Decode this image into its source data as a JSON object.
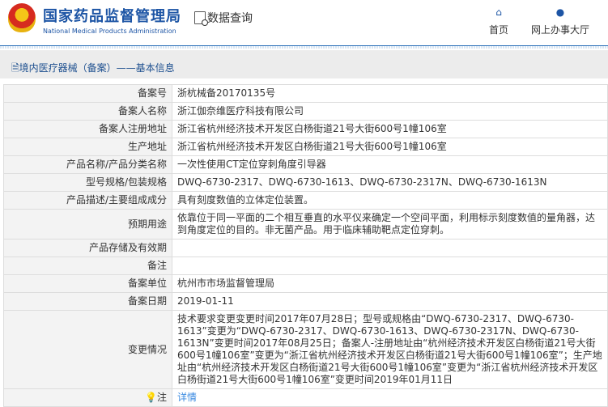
{
  "header": {
    "title_cn": "国家药品监督管理局",
    "title_en": "National Medical Products Administration",
    "section": "数据查询",
    "nav": [
      {
        "label": "首页",
        "icon": "home-icon"
      },
      {
        "label": "网上办事大厅",
        "icon": "user-icon"
      }
    ]
  },
  "breadcrumb": "境内医疗器械（备案）——基本信息",
  "rows": [
    {
      "k": "备案号",
      "v": "浙杭械备20170135号"
    },
    {
      "k": "备案人名称",
      "v": "浙江伽奈维医疗科技有限公司"
    },
    {
      "k": "备案人注册地址",
      "v": "浙江省杭州经济技术开发区白杨街道21号大街600号1幢106室"
    },
    {
      "k": "生产地址",
      "v": "浙江省杭州经济技术开发区白杨街道21号大街600号1幢106室"
    },
    {
      "k": "产品名称/产品分类名称",
      "v": "一次性使用CT定位穿刺角度引导器"
    },
    {
      "k": "型号规格/包装规格",
      "v": "DWQ-6730-2317、DWQ-6730-1613、DWQ-6730-2317N、DWQ-6730-1613N"
    },
    {
      "k": "产品描述/主要组成成分",
      "v": "具有刻度数值的立体定位装置。"
    },
    {
      "k": "预期用途",
      "v": "依靠位于同一平面的二个相互垂直的水平仪来确定一个空间平面，利用标示刻度数值的量角器，达到角度定位的目的。非无菌产品。用于临床辅助靶点定位穿刺。"
    },
    {
      "k": "产品存储及有效期",
      "v": ""
    },
    {
      "k": "备注",
      "v": ""
    },
    {
      "k": "备案单位",
      "v": "杭州市市场监督管理局"
    },
    {
      "k": "备案日期",
      "v": "2019-01-11"
    },
    {
      "k": "变更情况",
      "v": "技术要求变更变更时间2017年07月28日；型号或规格由“DWQ-6730-2317、DWQ-6730-1613”变更为“DWQ-6730-2317、DWQ-6730-1613、DWQ-6730-2317N、DWQ-6730-1613N”变更时间2017年08月25日；备案人-注册地址由“杭州经济技术开发区白杨街道21号大街600号1幢106室”变更为“浙江省杭州经济技术开发区白杨街道21号大街600号1幢106室”；生产地址由“杭州经济技术开发区白杨街道21号大街600号1幢106室”变更为“浙江省杭州经济技术开发区白杨街道21号大街600号1幢106室”变更时间2019年01月11日"
    }
  ],
  "note": {
    "k": "注",
    "link": "详情"
  }
}
